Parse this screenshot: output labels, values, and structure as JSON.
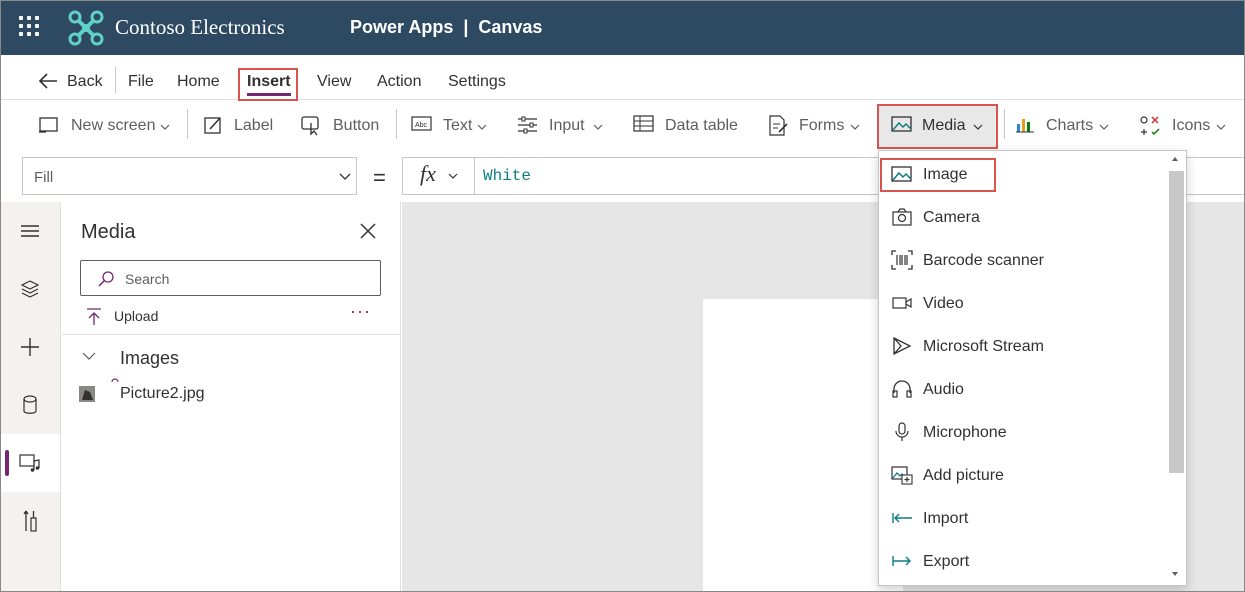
{
  "header": {
    "brand": "Contoso Electronics",
    "app": "Power Apps  |  Canvas"
  },
  "menu": {
    "back": "Back",
    "items": [
      "File",
      "Home",
      "Insert",
      "View",
      "Action",
      "Settings"
    ],
    "selected": "Insert"
  },
  "toolbar": {
    "new_screen": "New screen",
    "label": "Label",
    "button": "Button",
    "text": "Text",
    "input": "Input",
    "data_table": "Data table",
    "forms": "Forms",
    "media": "Media",
    "charts": "Charts",
    "icons": "Icons"
  },
  "formula_bar": {
    "property": "Fill",
    "equals": "=",
    "fx": "fx",
    "value": "White"
  },
  "panel": {
    "title": "Media",
    "search_placeholder": "Search",
    "upload": "Upload",
    "more": "···",
    "section": "Images",
    "files": [
      "Picture2.jpg"
    ]
  },
  "media_menu": {
    "items": [
      {
        "label": "Image",
        "icon": "image-icon"
      },
      {
        "label": "Camera",
        "icon": "camera-icon"
      },
      {
        "label": "Barcode scanner",
        "icon": "barcode-icon"
      },
      {
        "label": "Video",
        "icon": "video-icon"
      },
      {
        "label": "Microsoft Stream",
        "icon": "stream-icon"
      },
      {
        "label": "Audio",
        "icon": "headphones-icon"
      },
      {
        "label": "Microphone",
        "icon": "microphone-icon"
      },
      {
        "label": "Add picture",
        "icon": "add-picture-icon"
      },
      {
        "label": "Import",
        "icon": "import-icon"
      },
      {
        "label": "Export",
        "icon": "export-icon"
      }
    ],
    "highlighted": "Image"
  },
  "colors": {
    "header_bg": "#2e4a62",
    "accent": "#742774",
    "teal": "#0e7c86",
    "highlight": "#d9534f"
  }
}
